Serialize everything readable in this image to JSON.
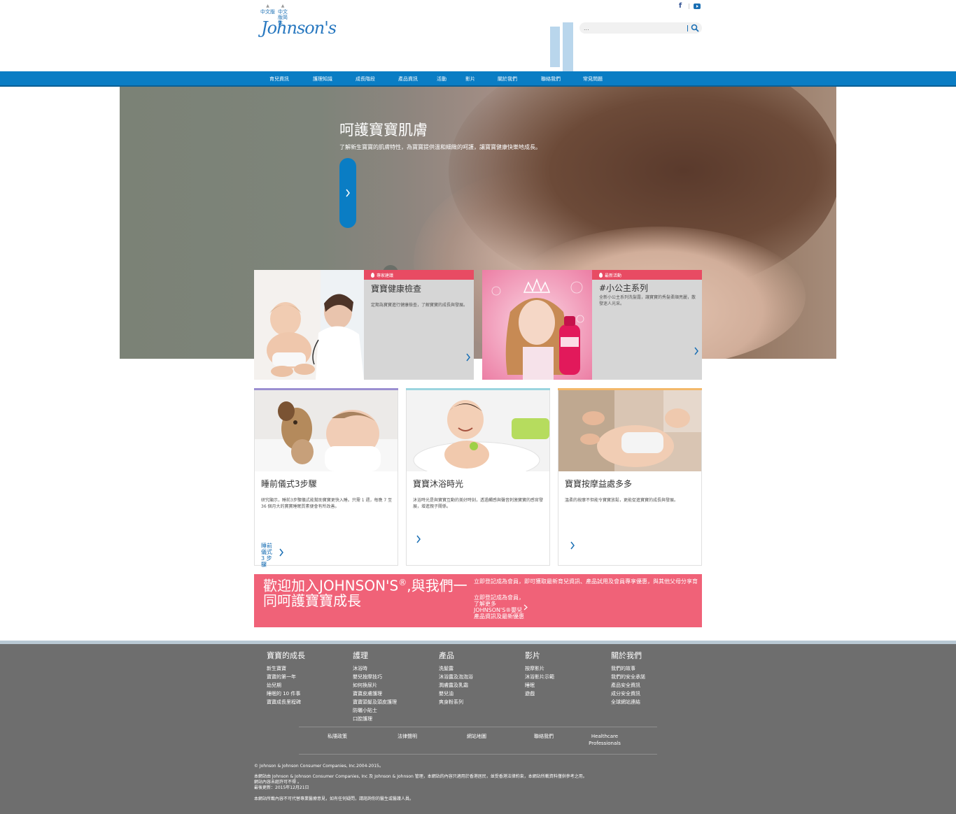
{
  "header": {
    "lang_links": [
      "中文版",
      "中文版简体"
    ],
    "logo_text": "Johnson's",
    "search": {
      "placeholder": "..."
    },
    "social": [
      "facebook-icon",
      "youtube-icon"
    ]
  },
  "nav": {
    "items": [
      "育兒資訊",
      "護理知識",
      "成長階段",
      "產品資訊",
      "活動",
      "影片",
      "關於我們",
      "聯絡我們",
      "常見問題"
    ]
  },
  "hero": {
    "title": "呵護寶寶肌膚",
    "subtitle": "了解新生寶寶的肌膚特性，為寶寶提供溫和細緻的呵護，讓寶寶健康快樂地成長。"
  },
  "feature_cards": [
    {
      "tag": "專家建議",
      "title": "寶寶健康檢查",
      "text": "定期為寶寶進行健康檢查，了解寶寶的成長與發展。"
    },
    {
      "tag": "最新活動",
      "title": "#小公主系列",
      "text": "全新小公主系列洗髮露，讓寶寶的秀髮柔順亮麗，散發迷人光采。"
    }
  ],
  "article_cards": [
    {
      "title": "睡前儀式3步驟",
      "text": "研究顯示，睡前3步驟儀式能幫助寶寶更快入睡。只需 1 週，每晚 7 至 36 個月大的寶寶睡眠質素便會有所改善。",
      "more": "睡前儀式 3 步驟",
      "accent": "#9b8fd1"
    },
    {
      "title": "寶寶沐浴時光",
      "text": "沐浴時光是與寶寶互動的美好時刻，透過觸感與聲音刺激寶寶的感官發展，增進親子關係。",
      "more": "",
      "accent": "#9bd5df"
    },
    {
      "title": "寶寶按摩益處多多",
      "text": "溫柔的按摩不但能令寶寶放鬆，更能促進寶寶的成長與發展。",
      "more": "",
      "accent": "#f3b86a"
    }
  ],
  "banner": {
    "title": "歡迎加入JOHNSON'S",
    "title_tail": ",與我們一同呵護寶寶成長",
    "line": "立即登記成為會員，即可獲取最新育兒資訊、產品試用及會員專享優惠，與其他父母分享育兒心得。",
    "link": "立即登記成為會員，了解更多 JOHNSON'S®嬰兒產品資訊及最新優惠"
  },
  "footer": {
    "columns": [
      {
        "heading": "寶寶的成長",
        "items": [
          "新生寶寶",
          "寶寶的第一年",
          "幼兒期",
          "睡眠的 10 件事",
          "寶寶成長里程碑"
        ]
      },
      {
        "heading": "護理",
        "items": [
          "沐浴時",
          "嬰兒按摩技巧",
          "如何換尿片",
          "寶寶皮膚護理",
          "寶寶頭髮及頭皮護理",
          "防曬小貼士",
          "口腔護理"
        ]
      },
      {
        "heading": "產品",
        "items": [
          "洗髮露",
          "沐浴露及泡泡浴",
          "潤膚露及乳霜",
          "嬰兒油",
          "爽身粉系列"
        ]
      },
      {
        "heading": "影片",
        "items": [
          "按摩影片",
          "沐浴影片示範",
          "睡眠",
          "遊戲"
        ]
      },
      {
        "heading": "關於我們",
        "items": [
          "我們的故事",
          "我們的安全承諾",
          "產品安全資訊",
          "成分安全資訊",
          "全球網站連結"
        ]
      }
    ],
    "bottom_links": [
      "私隱政策",
      "法律聲明",
      "網站地圖",
      "聯絡我們",
      "Healthcare Professionals"
    ],
    "copyright": "© Johnson & Johnson Consumer Companies, Inc.2004-2015。",
    "legal1": "本網站由 Johnson & Johnson Consumer Companies, Inc 及 Johnson & Johnson 管理，本網站的內容只適用於香港居民，並受香港法律約束，本網站所載資料僅供參考之用。",
    "legal2": "網站內容未經許可不得 。",
    "legal3": "最後更新：2015年12月21日",
    "legal4": "本網站所載內容不可代替專業醫療意見，如有任何疑問，請諮詢你的醫生或醫護人員。"
  },
  "colors": {
    "brand_blue": "#0a7dc4",
    "pink": "#f06278",
    "footer_grey": "#6e6e6e"
  }
}
